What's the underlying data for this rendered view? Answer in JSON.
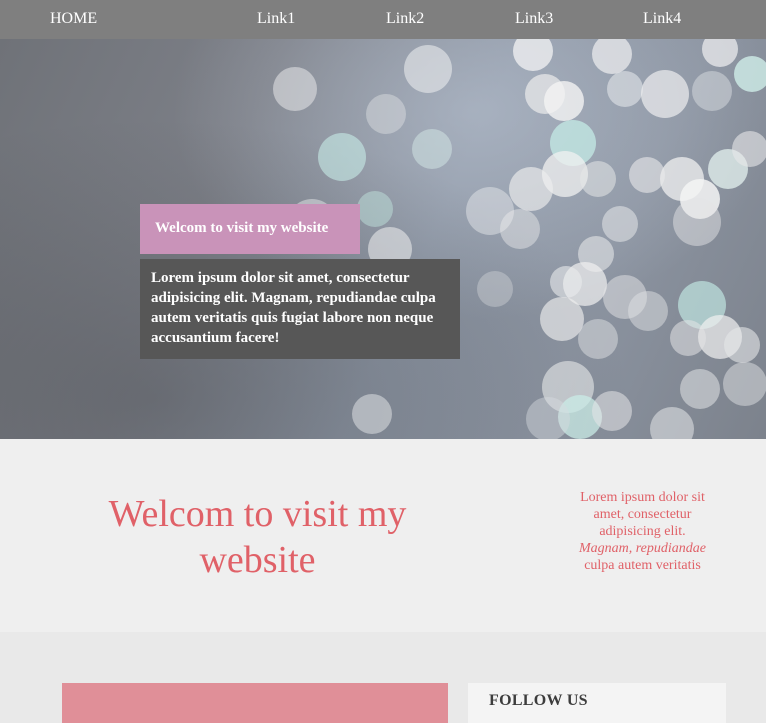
{
  "nav": {
    "items": [
      "HOME",
      "Link1",
      "Link2",
      "Link3",
      "Link4"
    ]
  },
  "hero": {
    "tag": "Welcom to visit my website",
    "text": "Lorem ipsum dolor sit amet, consectetur adipisicing elit. Magnam, repudiandae culpa autem veritatis quis fugiat labore non neque accusantium facere!"
  },
  "welcome": {
    "title": "Welcom to visit my website",
    "side_line1": "Lorem ipsum dolor sit amet, consectetur adipisicing elit.",
    "side_italic": "Magnam, repudiandae",
    "side_line2": "culpa autem veritatis"
  },
  "follow": {
    "title": "FOLLOW US"
  },
  "colors": {
    "nav_bg": "#7f7f7f",
    "tag_bg": "#c993b9",
    "text_box_bg": "#575757",
    "accent": "#e06168",
    "pink_box": "#e08f98"
  }
}
